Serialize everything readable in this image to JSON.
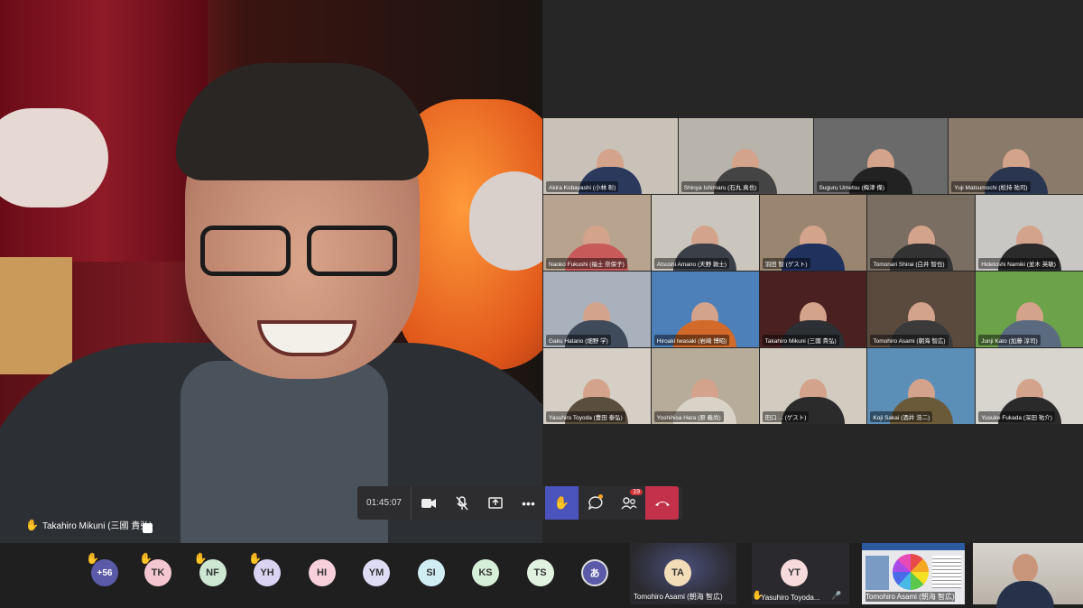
{
  "spotlight": {
    "name": "Takahiro Mikuni (三國 貴弘)"
  },
  "grid_top": [
    {
      "name": "Akira Kobayashi (小林 彰)",
      "bg": "#c9c2b8",
      "shirt": "#2b3a5c"
    },
    {
      "name": "Shinya Ishimaru (石丸 真也)",
      "bg": "#b8b3ab",
      "shirt": "#444"
    },
    {
      "name": "Suguru Umetsu (梅津 傑)",
      "bg": "#6a6a6a",
      "shirt": "#222"
    },
    {
      "name": "Yuji Matsumochi (松持 祐司)",
      "bg": "#8a7a6a",
      "shirt": "#2a3550"
    }
  ],
  "grid_rows": [
    {
      "name": "Naoko Fukushi (福士 奈保子)",
      "bg": "#b8a48e",
      "shirt": "#c95a5a"
    },
    {
      "name": "Atsushi Amano (天野 敦士)",
      "bg": "#cbc6bd",
      "shirt": "#3a3f48"
    },
    {
      "name": "羽田 智 (ゲスト)",
      "bg": "#9a8670",
      "shirt": "#20315e"
    },
    {
      "name": "Tomonari Shirai (白井 智也)",
      "bg": "#7a6e62",
      "shirt": "#333"
    },
    {
      "name": "Hidetoshi Namiki (並木 英敏)",
      "bg": "#c9c7c3",
      "shirt": "#2b2b2b"
    },
    {
      "name": "Gaku Hatano (畑野 学)",
      "bg": "#a9b1bd",
      "shirt": "#3f4a5a"
    },
    {
      "name": "Hiroaki Iwasaki (岩崎 博昭)",
      "bg": "#4d7fb8",
      "shirt": "#d16a2a"
    },
    {
      "name": "Takahiro Mikuni (三國 貴弘)",
      "bg": "#4a2020",
      "shirt": "#2c2f33"
    },
    {
      "name": "Tomohiro Asami (朝海 智広)",
      "bg": "#5a4a3e",
      "shirt": "#3a3a3a"
    },
    {
      "name": "Junji Kato (加藤 淳司)",
      "bg": "#6ca34a",
      "shirt": "#5a6b80"
    },
    {
      "name": "Yasuhiro Toyoda (豊田 泰弘)",
      "bg": "#d6cfc6",
      "shirt": "#5a4e3e"
    },
    {
      "name": "Yoshihisa Hara (原 義尚)",
      "bg": "#b7ab99",
      "shirt": "#d9d3c7"
    },
    {
      "name": "田口 ... (ゲスト)",
      "bg": "#d2cbbf",
      "shirt": "#2b2b2b"
    },
    {
      "name": "Koji Sakai (酒井 浩二)",
      "bg": "#5c8fb8",
      "shirt": "#6a5a3a"
    },
    {
      "name": "Yusuke Fukada (深田 祐介)",
      "bg": "#d8d4ce",
      "shirt": "#2a2a2a"
    }
  ],
  "controls": {
    "timer": "01:45:07",
    "participants_badge": "19"
  },
  "strip": {
    "overflow_count": "+56",
    "avatars": [
      {
        "initials": "TK",
        "bg": "#f4c6cf",
        "hand": true
      },
      {
        "initials": "NF",
        "bg": "#cde7d3",
        "hand": true
      },
      {
        "initials": "YH",
        "bg": "#dbd3f2",
        "hand": true
      },
      {
        "initials": "HI",
        "bg": "#f7d0dc",
        "hand": false
      },
      {
        "initials": "YM",
        "bg": "#dedcf5",
        "hand": false
      },
      {
        "initials": "SI",
        "bg": "#d0edf4",
        "hand": false
      },
      {
        "initials": "KS",
        "bg": "#d6efd8",
        "hand": false
      },
      {
        "initials": "TS",
        "bg": "#e2f2e0",
        "hand": false
      },
      {
        "initials": "あ",
        "bg": "#5a5aa8",
        "hand": false
      }
    ],
    "tile_ta": {
      "initials": "TA",
      "name": "Tomohiro Asami (朝海 智広)"
    },
    "tile_yt": {
      "initials": "YT",
      "name": "Yasuhiro Toyoda..."
    },
    "share_name": "Tomohiro Asami (朝海 智広)"
  }
}
